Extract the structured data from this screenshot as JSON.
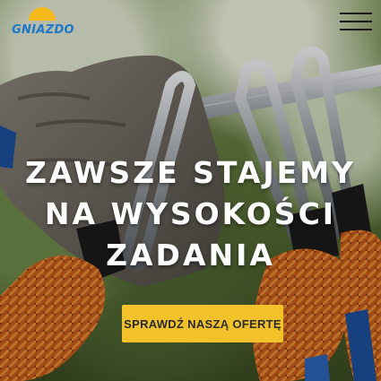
{
  "brand": {
    "name": "GNIAZDO",
    "colors": {
      "sun": "#f4b81b",
      "text": "#1f77c9"
    }
  },
  "header": {
    "menu_icon": "hamburger-menu-icon"
  },
  "hero": {
    "headline_lines": [
      "ZAWSZE STAJEMY",
      "NA WYSOKOŚCI",
      "ZADANIA"
    ],
    "cta_label": "SPRAWDŹ NASZĄ OFERTĘ",
    "cta_color": "#f3c22b"
  }
}
